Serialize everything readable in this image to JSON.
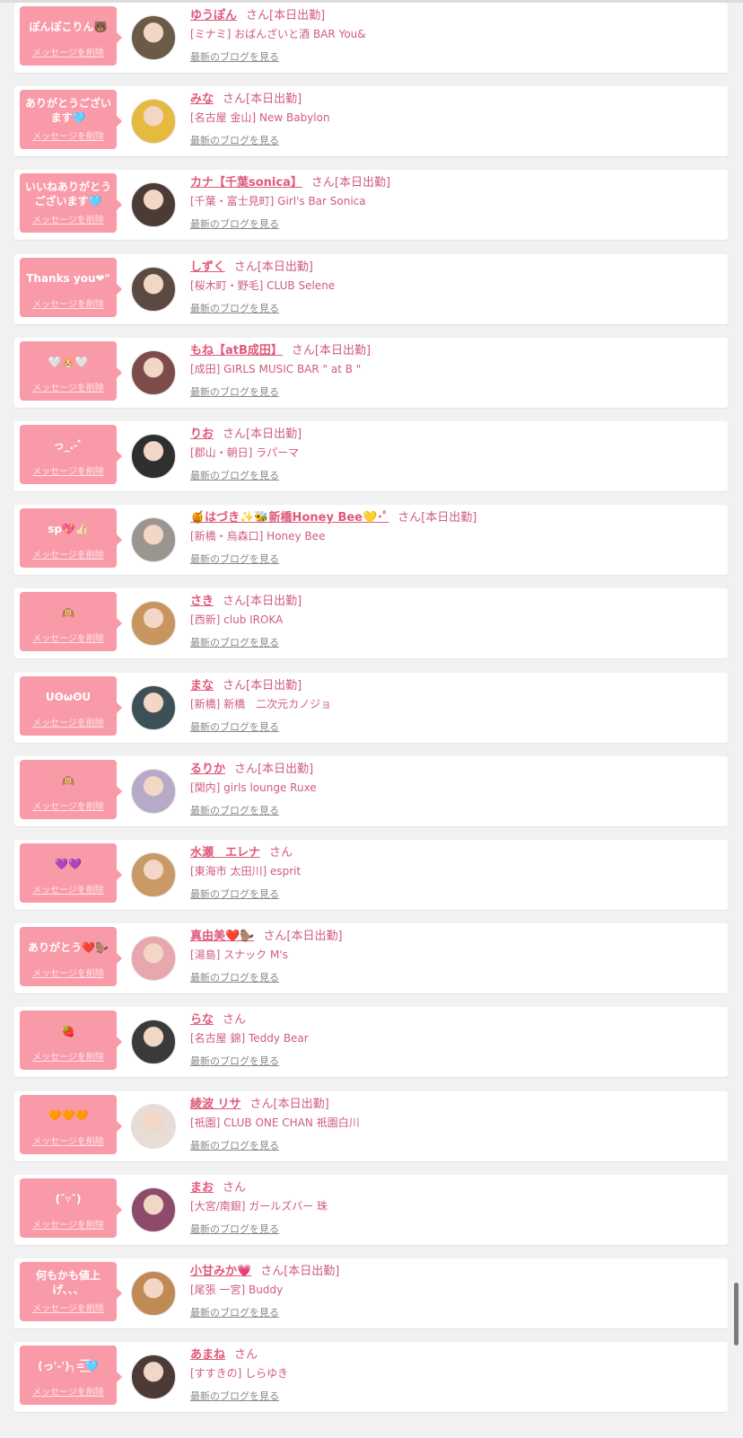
{
  "labels": {
    "delete": "メッセージを削除",
    "blog": "最新のブログを見る",
    "san": "さん"
  },
  "entries": [
    {
      "message": "ぽんぽこりん🐻",
      "name": "ゆうぽん",
      "status": "[本日出勤]",
      "shop": "[ミナミ] おばんざいと酒 BAR You&",
      "avatar_color": "#6b5a45"
    },
    {
      "message": "ありがとうございます🩵",
      "name": "みな",
      "status": "[本日出勤]",
      "shop": "[名古屋 金山] New Babylon",
      "avatar_color": "#e6b93f"
    },
    {
      "message": "いいねありがとうございます🩵",
      "name": "カナ【千葉sonica】",
      "status": "[本日出勤]",
      "shop": "[千葉・富士見町] Girl's Bar Sonica",
      "avatar_color": "#4a3b36"
    },
    {
      "message": "Thanks you❤︎\"",
      "name": "しずく",
      "status": "[本日出勤]",
      "shop": "[桜木町・野毛] CLUB Selene",
      "avatar_color": "#5b4a40"
    },
    {
      "message": "🤍🐹🤍",
      "name": "もね【atB成田】",
      "status": "[本日出勤]",
      "shop": "[成田] GIRLS MUSIC BAR \" at B \"",
      "avatar_color": "#7e4b4b"
    },
    {
      "message": "っ_.-ﾞ",
      "name": "りお",
      "status": "[本日出勤]",
      "shop": "[郡山・朝日] ラパーマ",
      "avatar_color": "#2f2f2f"
    },
    {
      "message": "sp💖👍🏻",
      "name": "🍯はづき✨🐝新橋Honey Bee💛･ﾟ",
      "status": "[本日出勤]",
      "shop": "[新橋・烏森口] Honey Bee",
      "avatar_color": "#9b9590"
    },
    {
      "message": "🙉",
      "name": "さき",
      "status": "[本日出勤]",
      "shop": "[西新] club IROKA",
      "avatar_color": "#c8955e"
    },
    {
      "message": "UʘωʘU",
      "name": "まな",
      "status": "[本日出勤]",
      "shop": "[新橋] 新橋　二次元カノジョ",
      "avatar_color": "#3d4f57"
    },
    {
      "message": "🙉",
      "name": "るりか",
      "status": "[本日出勤]",
      "shop": "[関内] girls lounge Ruxe",
      "avatar_color": "#b7aac8"
    },
    {
      "message": "💜💜",
      "name": "水瀬　エレナ",
      "status": "",
      "shop": "[東海市 太田川] esprit",
      "avatar_color": "#c99a66"
    },
    {
      "message": "ありがとう❤️🦫",
      "name": "真由美❤️🦫",
      "status": "[本日出勤]",
      "shop": "[湯島] スナック M's",
      "avatar_color": "#e7a7ad"
    },
    {
      "message": "🍓",
      "name": "らな",
      "status": "",
      "shop": "[名古屋 錦] Teddy Bear",
      "avatar_color": "#3a3a3a"
    },
    {
      "message": "🧡🧡🧡",
      "name": "綾波 リサ",
      "status": "[本日出勤]",
      "shop": "[祇園] CLUB ONE CHAN 祇園白川",
      "avatar_color": "#e7dcd6"
    },
    {
      "message": "(ˆ▿ˆ)",
      "name": "まお",
      "status": "",
      "shop": "[大宮/南銀] ガールズバー 珠",
      "avatar_color": "#8d4a6a"
    },
    {
      "message": "何もかも値上げ、、、",
      "name": "小甘みか💗",
      "status": "[本日出勤]",
      "shop": "[尾張 一宮] Buddy",
      "avatar_color": "#c08a55"
    },
    {
      "message": "(っ'-')╮=͟͟͞͞🩵",
      "name": "あまね",
      "status": "",
      "shop": "[すすきの] しらゆき",
      "avatar_color": "#4b3a36"
    }
  ]
}
